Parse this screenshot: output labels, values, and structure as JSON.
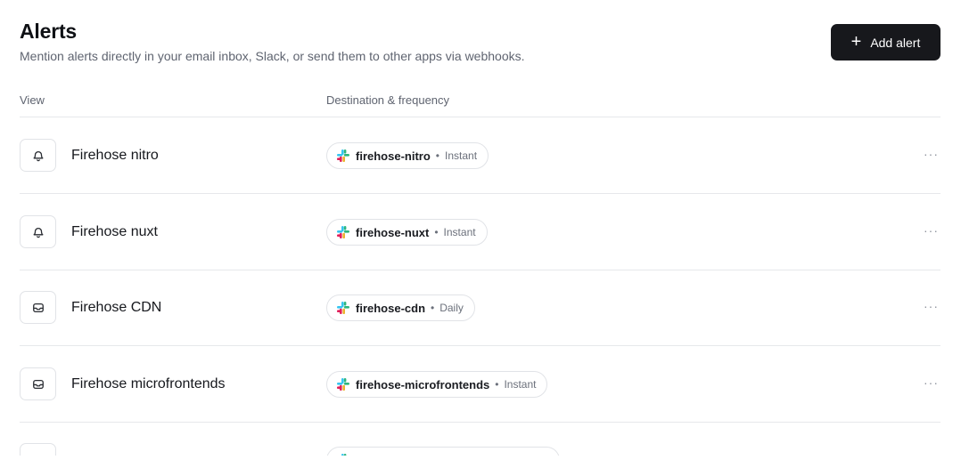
{
  "header": {
    "title": "Alerts",
    "subtitle": "Mention alerts directly in your email inbox, Slack, or send them to other apps via webhooks."
  },
  "actions": {
    "add_alert_label": "Add alert",
    "plus_icon": "plus-icon"
  },
  "columns": {
    "view": "View",
    "destination": "Destination & frequency"
  },
  "rows": [
    {
      "name": "Firehose nitro",
      "icon": "bell-icon",
      "channel": "firehose-nitro",
      "separator": "•",
      "frequency": "Instant"
    },
    {
      "name": "Firehose nuxt",
      "icon": "bell-icon",
      "channel": "firehose-nuxt",
      "separator": "•",
      "frequency": "Instant"
    },
    {
      "name": "Firehose CDN",
      "icon": "inbox-icon",
      "channel": "firehose-cdn",
      "separator": "•",
      "frequency": "Daily"
    },
    {
      "name": "Firehose microfrontends",
      "icon": "inbox-icon",
      "channel": "firehose-microfrontends",
      "separator": "•",
      "frequency": "Instant"
    },
    {
      "name": "",
      "icon": "inbox-icon",
      "channel": "",
      "separator": "",
      "frequency": ""
    }
  ],
  "more_label": "···",
  "colors": {
    "button_bg": "#17181c",
    "slack_blue": "#36C5F0",
    "slack_green": "#2EB67D",
    "slack_red": "#E01E5A",
    "slack_yellow": "#ECB22E"
  }
}
